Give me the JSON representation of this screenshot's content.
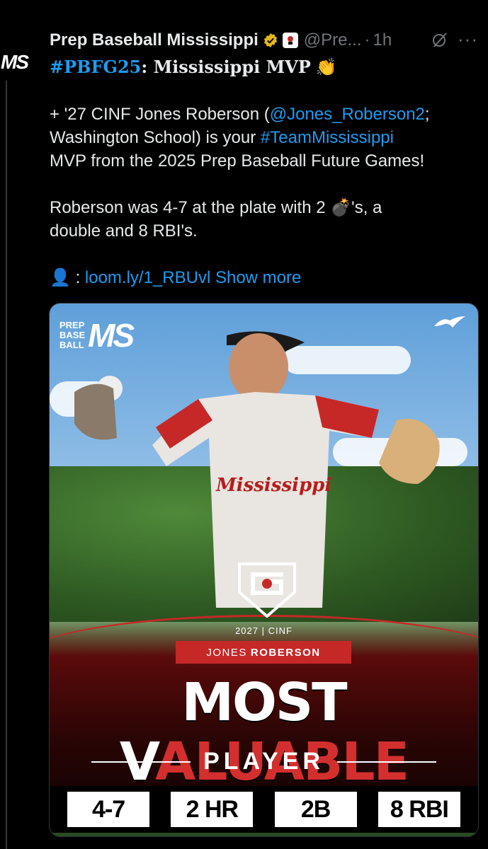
{
  "avatar": {
    "label": "MS"
  },
  "post": {
    "author_name": "Prep Baseball Mississippi",
    "handle": "@Pre...",
    "separator": "·",
    "time": "1h",
    "more": "···",
    "headline_tag": "#PBFG25",
    "headline_rest": ": Mississippi MVP",
    "clap_emoji": "👏",
    "para1_line1_prefix": "+ '27 CINF Jones Roberson (",
    "para1_mention": "@Jones_Roberson2",
    "para1_line1_suffix": ";",
    "para1_line2_prefix": "Washington School) is your ",
    "para1_hashtag": "#TeamMississippi",
    "para1_line3": "MVP from the 2025 Prep Baseball Future Games!",
    "para2_line1_prefix": "Roberson was 4-7 at the plate with 2 ",
    "bomb_emoji": "💣",
    "para2_line1_suffix": "'s, a",
    "para2_line2": "double and 8 RBI's.",
    "link_emoji": "👤",
    "link_colon": ":",
    "link_text": "loom.ly/1_RBUvl",
    "show_more": "Show more"
  },
  "graphic": {
    "logo_stack": [
      "PREP",
      "BASE",
      "BALL"
    ],
    "logo_ms": "MS",
    "year_position": "2027 | CINF",
    "first_name": "JONES",
    "last_name": "ROBERSON",
    "title_white": "MOST V",
    "title_red": "ALUABLE",
    "subtitle": "PLAYER",
    "jersey_text": "Mississippi",
    "stats": [
      "4-7",
      "2 HR",
      "2B",
      "8 RBI"
    ]
  },
  "colors": {
    "link": "#1d9bf0",
    "accent_red": "#c62828",
    "muted": "#71767b"
  }
}
